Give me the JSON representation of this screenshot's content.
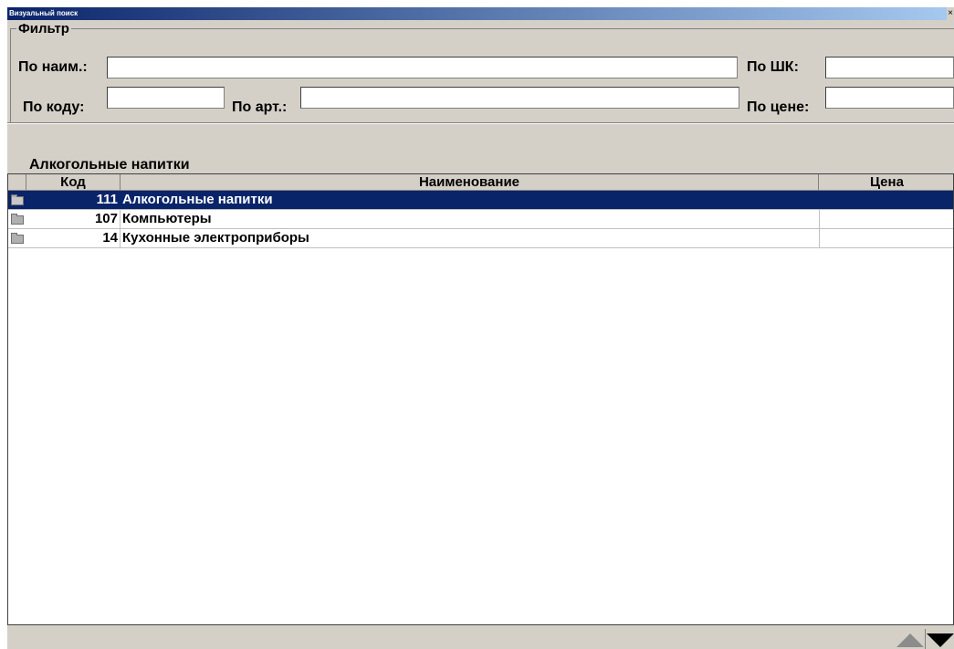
{
  "window": {
    "title": "Визуальный поиск",
    "close_glyph": "×"
  },
  "filter": {
    "legend": "Фильтр",
    "by_name_label": "По наим.:",
    "by_name_value": "",
    "by_barcode_label": "По ШК:",
    "by_barcode_value": "",
    "by_code_label": "По коду:",
    "by_code_value": "",
    "by_article_label": "По арт.:",
    "by_article_value": "",
    "by_price_label": "По цене:",
    "by_price_value": ""
  },
  "group": {
    "title": "Алкогольные напитки"
  },
  "table": {
    "columns": [
      "Код",
      "Наименование",
      "Цена"
    ],
    "rows": [
      {
        "icon": "folder-icon",
        "code": "111",
        "name": "Алкогольные напитки",
        "price": "",
        "selected": true
      },
      {
        "icon": "folder-icon",
        "code": "107",
        "name": "Компьютеры",
        "price": "",
        "selected": false
      },
      {
        "icon": "folder-icon",
        "code": "14",
        "name": "Кухонные электроприборы",
        "price": "",
        "selected": false
      }
    ]
  },
  "navigation": {
    "up_icon": "triangle-up-icon",
    "down_icon": "triangle-down-icon"
  },
  "colors": {
    "selection": "#0a246a",
    "face": "#d4d0c8"
  }
}
